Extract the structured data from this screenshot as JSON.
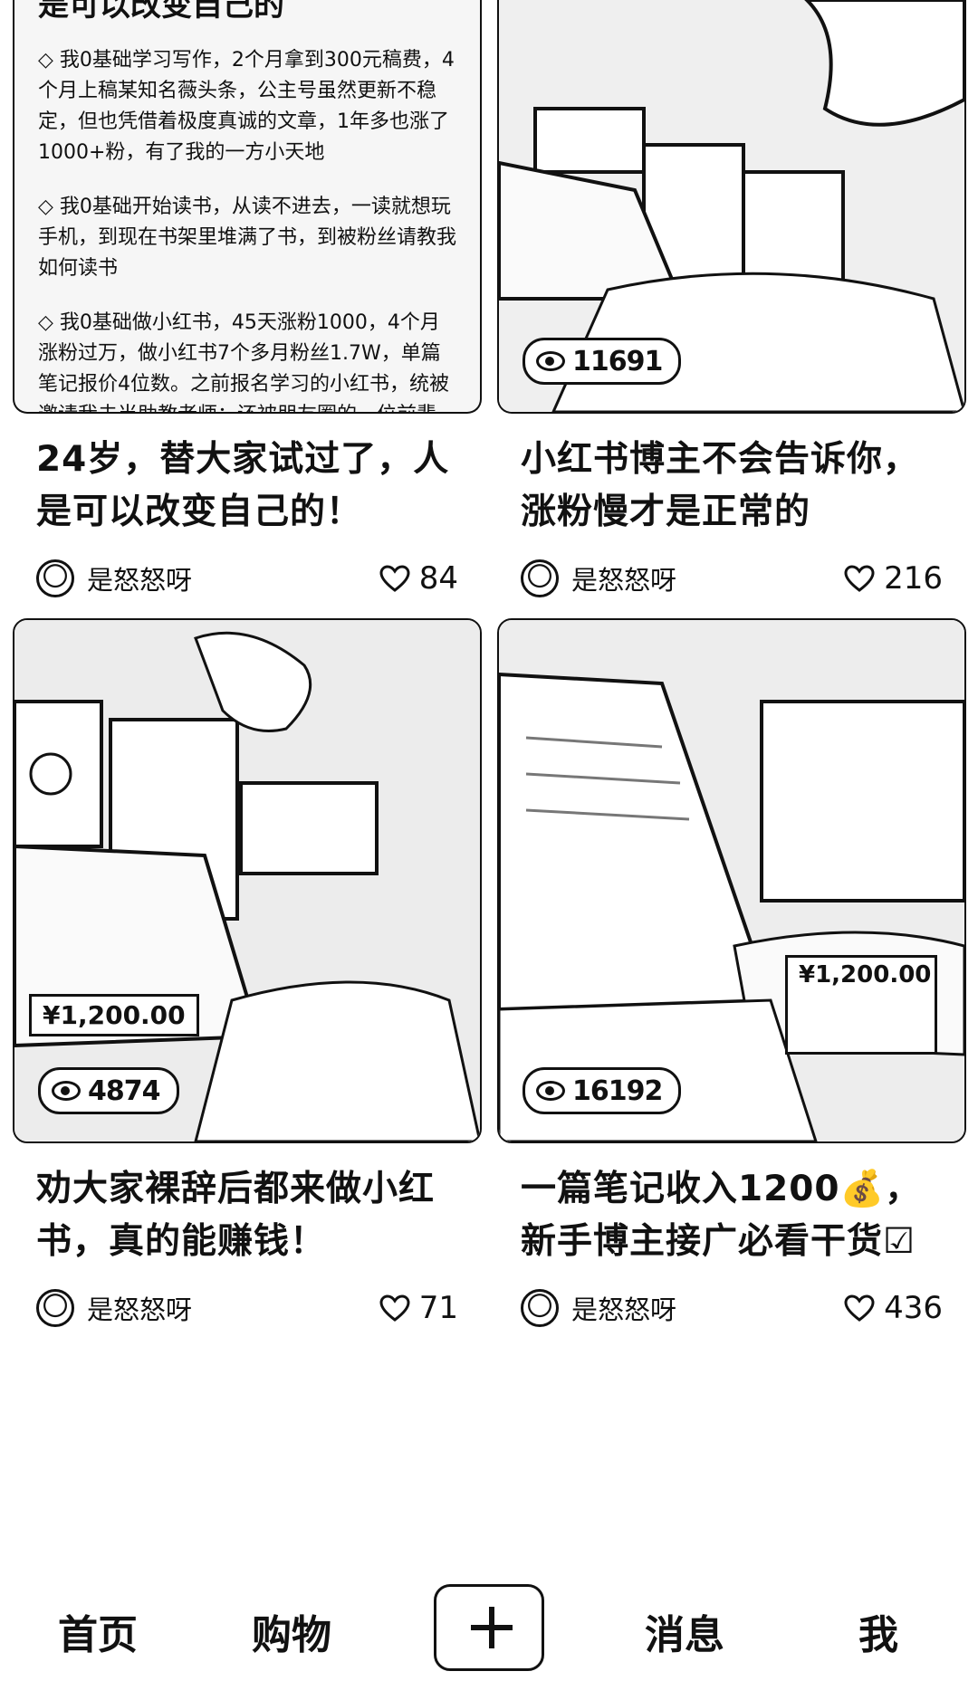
{
  "feed": {
    "cards": [
      {
        "thumb_snippet_title": "是可以改变自己的",
        "thumb_text": [
          "◇ 我0基础学习写作，2个月拿到300元稿费，4个月上稿某知名薇头条，公主号虽然更新不稳定，但也凭借着极度真诚的文章，1年多也涨了1000+粉，有了我的一方小天地",
          "◇ 我0基础开始读书，从读不进去，一读就想玩手机，到现在书架里堆满了书，到被粉丝请教我如何读书",
          "◇ 我0基础做小红书，45天涨粉1000，4个月涨粉过万，做小红书7个多月粉丝1.7W，单篇笔记报价4位数。之前报名学习的小红书，统被邀请我去当助教老师；还被朋友圈的一位前辈，tui荐给B端教育机构，帮忙"
        ],
        "views": "",
        "title": "24岁，替大家试过了，人是可以改变自己的！",
        "author": "是怒怒呀",
        "likes": "84"
      },
      {
        "views": "11691",
        "title": "小红书博主不会告诉你，涨粉慢才是正常的",
        "author": "是怒怒呀",
        "likes": "216"
      },
      {
        "price": "¥1,200.00",
        "views": "4874",
        "title": "劝大家裸辞后都来做小红书，真的能赚钱！",
        "author": "是怒怒呀",
        "likes": "71"
      },
      {
        "price": "¥1,200.00",
        "views": "16192",
        "title": "一篇笔记收入1200💰，新手博主接广必看干货☑",
        "author": "是怒怒呀",
        "likes": "436"
      }
    ]
  },
  "tabbar": {
    "home": "首页",
    "shop": "购物",
    "messages": "消息",
    "me": "我"
  }
}
